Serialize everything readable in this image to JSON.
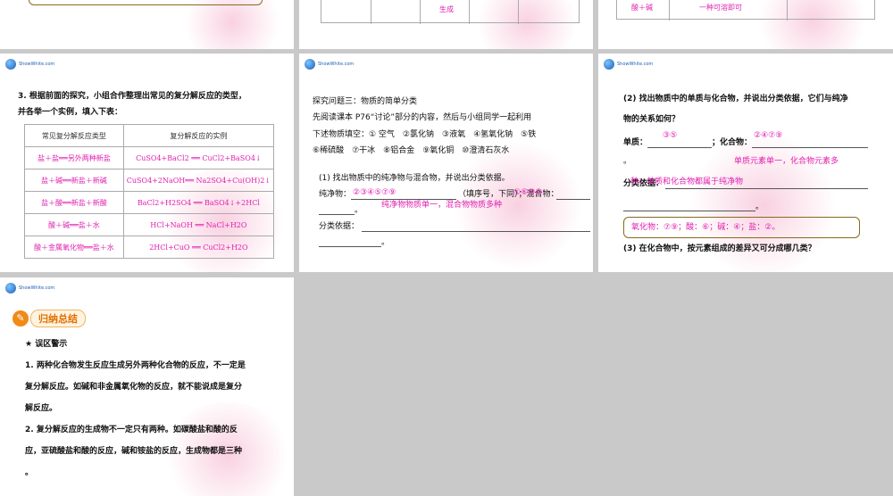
{
  "slide_top_mid": {
    "cell_text": "生成"
  },
  "slide_top_right": {
    "cell_left": "酸＋碱",
    "cell_mid": "一种可溶即可"
  },
  "slide_table": {
    "question": [
      "3. 根据前面的探究，小组合作整理出常见的复分解反应的类型，",
      "并各举一个实例，填入下表："
    ],
    "header": [
      "常见复分解反应类型",
      "复分解反应的实例"
    ],
    "rows": [
      [
        "盐＋盐══另外两种新盐",
        "CuSO4+BaCl2 ══ CuCl2+BaSO4↓"
      ],
      [
        "盐＋碱══新盐＋新碱",
        "CuSO4+2NaOH══ Na2SO4+Cu(OH)2↓"
      ],
      [
        "盐＋酸══新盐＋新酸",
        "BaCl2+H2SO4 ══ BaSO4↓+2HCl"
      ],
      [
        "酸＋碱══盐＋水",
        "HCl+NaOH ══ NaCl+H2O"
      ],
      [
        "酸＋金属氧化物══盐＋水",
        "2HCl+CuO ══ CuCl2+H2O"
      ]
    ]
  },
  "slide_mid": {
    "title": "探究问题三：物质的简单分类",
    "p1": "先阅读课本 P76“讨论”部分的内容，然后与小组同学一起利用",
    "p2": "下述物质填空：① 空气　②氯化钠　③液氧　④氢氧化钠　⑤铁",
    "p3": "⑥稀硫酸　⑦干冰　⑧铝合金　⑨氧化铜　⑩澄清石灰水",
    "q1": "(1) 找出物质中的纯净物与混合物，并说出分类依据。",
    "pure_label": "纯净物：",
    "pure_answer": "②③④⑤⑦⑨",
    "mid_text": "（填序号，下同）；混合物：",
    "mix_answer": "①⑥⑧⑩",
    "period1": "。",
    "basis_answer": "纯净物物质单一，混合物物质多种",
    "basis_label": "分类依据：",
    "period2": "。"
  },
  "slide_right": {
    "q2a": "(2) 找出物质中的单质与化合物，并说出分类依据，它们与纯净",
    "q2b": "物的关系如何？",
    "element_label": "单质：",
    "element_answer": "③⑤",
    "compound_label": "；化合物：",
    "compound_answer": "②④⑦⑨",
    "period1": "。",
    "basis_answer1": "单质元素单一，化合物元素多",
    "basis_label": "分类依据：",
    "basis_answer2": "种；单质和化合物都属于纯净物",
    "period2": "。",
    "box_answer": "氧化物：⑦⑨；酸：⑥；碱：④；盐：②。",
    "q3": "(3) 在化合物中，按元素组成的差异又可分成哪几类？"
  },
  "slide_summary": {
    "badge": "归纳总结",
    "warn_title": "★ 误区警示",
    "lines": [
      "1. 两种化合物发生反应生成另外两种化合物的反应，不一定是",
      "复分解反应。如碱和非金属氧化物的反应，就不能说成是复分",
      "解反应。",
      "2. 复分解反应的生成物不一定只有两种。如碳酸盐和酸的反",
      "应，亚硫酸盐和酸的反应，碱和铵盐的反应，生成物都是三种",
      "。"
    ]
  },
  "logo": {
    "text": "ShowWhite.com"
  }
}
